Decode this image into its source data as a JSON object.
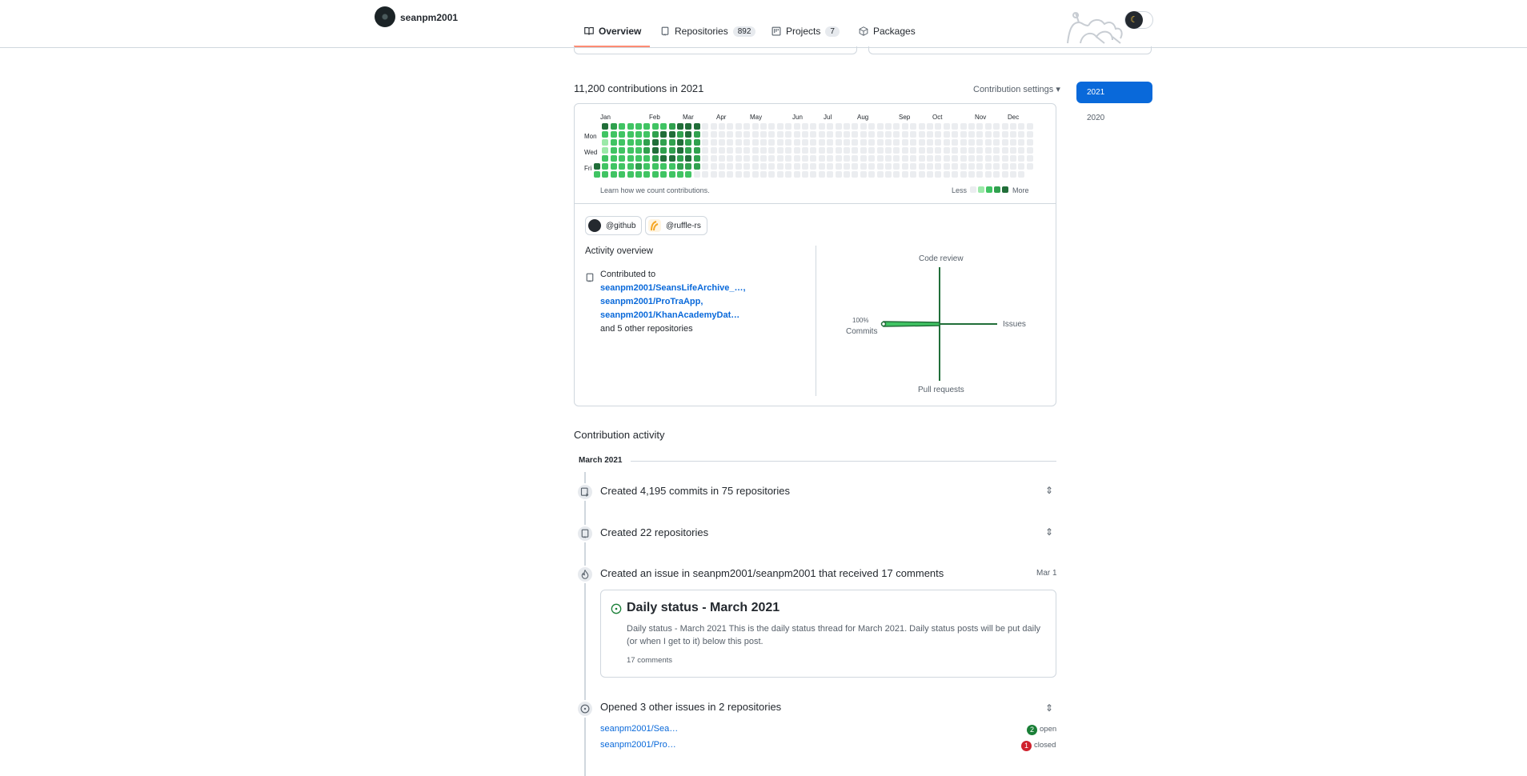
{
  "header": {
    "username": "seanpm2001",
    "tabs": [
      {
        "label": "Overview",
        "counter": ""
      },
      {
        "label": "Repositories",
        "counter": "892"
      },
      {
        "label": "Projects",
        "counter": "7"
      },
      {
        "label": "Packages",
        "counter": ""
      }
    ]
  },
  "contributions": {
    "title": "11,200 contributions in 2021",
    "settings_label": "Contribution settings ▾",
    "months": [
      "Jan",
      "Feb",
      "Mar",
      "Apr",
      "May",
      "Jun",
      "Jul",
      "Aug",
      "Sep",
      "Oct",
      "Nov",
      "Dec"
    ],
    "day_labels": [
      "Mon",
      "Wed",
      "Fri"
    ],
    "learn_link": "Learn how we count contributions.",
    "legend_less": "Less",
    "legend_more": "More",
    "levels": [
      "#ebedf0",
      "#9be9a8",
      "#40c463",
      "#30a14e",
      "#216e39"
    ],
    "active_weeks": 12
  },
  "years": [
    "2021",
    "2020"
  ],
  "orgs": [
    {
      "label": "@github",
      "color": "#24292f"
    },
    {
      "label": "@ruffle-rs",
      "color": "#f5a623"
    }
  ],
  "activity_overview": {
    "title": "Activity overview",
    "contributed_to": "Contributed to",
    "repos": [
      "seanpm2001/SeansLifeArchive_…,",
      "seanpm2001/ProTraApp,",
      "seanpm2001/KhanAcademyDat…"
    ],
    "other": "and 5 other repositories",
    "radar": {
      "code_review": "Code review",
      "issues": "Issues",
      "pull_requests": "Pull requests",
      "commits": "Commits",
      "commits_pct": "100%"
    }
  },
  "activity": {
    "heading": "Contribution activity",
    "month": "March 2021",
    "items": [
      {
        "text": "Created 4,195 commits in 75 repositories"
      },
      {
        "text": "Created 22 repositories"
      },
      {
        "text": "Created an issue in seanpm2001/seanpm2001 that received 17 comments",
        "date": "Mar 1"
      },
      {
        "text": "Opened 3 other issues in 2 repositories"
      }
    ],
    "issue": {
      "title": "Daily status - March 2021",
      "body": "Daily status - March 2021 This is the daily status thread for March 2021. Daily status posts will be put daily (or when I get to it) below this post.",
      "comments": "17 comments"
    },
    "other_issues": [
      {
        "repo": "seanpm2001/Sea…",
        "count": "2",
        "state": "open",
        "color": "#1a7f37"
      },
      {
        "repo": "seanpm2001/Pro…",
        "count": "1",
        "state": "closed",
        "color": "#cf222e"
      }
    ]
  }
}
